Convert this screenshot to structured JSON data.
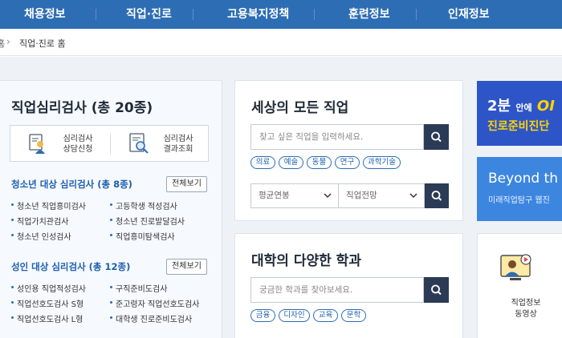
{
  "topnav": {
    "items": [
      "채용정보",
      "직업·진로",
      "고용복지정책",
      "훈련정보",
      "인재정보"
    ]
  },
  "breadcrumb": {
    "home": "홈",
    "current": "직업·진로 홈"
  },
  "psych_test": {
    "title": "직업심리검사 (총 20종)",
    "quick": [
      {
        "label_line1": "심리검사",
        "label_line2": "상담신청"
      },
      {
        "label_line1": "심리검사",
        "label_line2": "결과조회"
      }
    ],
    "youth": {
      "title": "청소년 대상 심리검사 (총 8종)",
      "all_label": "전체보기",
      "left": [
        "청소년 직업흥미검사",
        "직업가치관검사",
        "청소년 인성검사"
      ],
      "right": [
        "고등학생 적성검사",
        "청소년 진로발달검사",
        "직업흥미탐색검사"
      ]
    },
    "adult": {
      "title": "성인 대상 심리검사 (총 12종)",
      "all_label": "전체보기",
      "left": [
        "성인용 직업적성검사",
        "직업선호도검사 S형",
        "직업선호도검사 L형"
      ],
      "right": [
        "구직준비도검사",
        "준고령자 직업선호도검사",
        "대학생 진로준비도검사"
      ]
    }
  },
  "job_search": {
    "title": "세상의 모든 직업",
    "placeholder": "찾고 싶은 직업을 입력하세요.",
    "tags": [
      "의료",
      "예술",
      "동물",
      "연구",
      "과학기술"
    ],
    "select1": "평균연봉",
    "select2": "직업전망"
  },
  "dept_search": {
    "title": "대학의 다양한 학과",
    "placeholder": "궁금한 학과를 찾아보세요.",
    "tags": [
      "금융",
      "디자인",
      "교육",
      "문학"
    ]
  },
  "banners": {
    "b1_line1_a": "2분",
    "b1_line1_b": "안에",
    "b1_line1_c": "OI",
    "b1_line2": "진로준비진단",
    "b2_line1": "Beyond th",
    "b2_line2": "미래직업탐구 웹진"
  },
  "video_card": {
    "line1": "직업정보",
    "line2": "동영상"
  },
  "colors": {
    "nav_blue": "#2d6db4",
    "accent_blue": "#1d5fb0",
    "search_button": "#2b3a55",
    "page_bg": "#eef2f7"
  }
}
